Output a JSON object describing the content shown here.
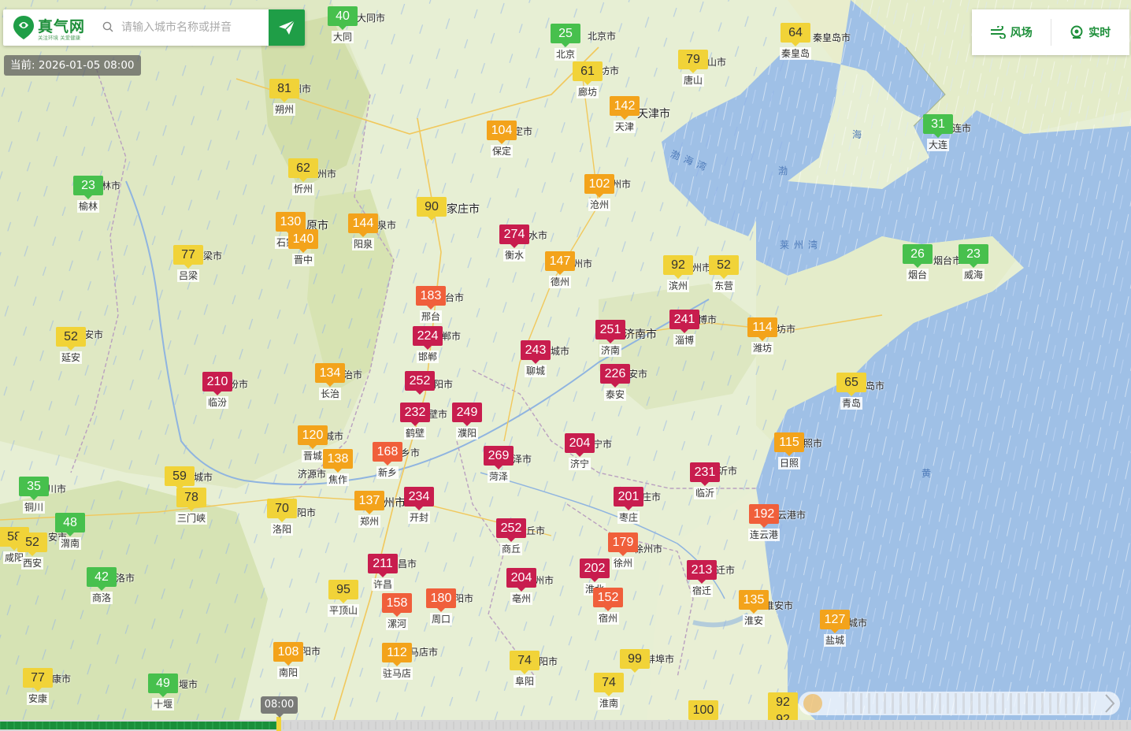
{
  "app": {
    "logo_name": "真气网",
    "logo_tagline": "关注环境 关爱健康",
    "search_placeholder": "请输入城市名称或拼音",
    "current_time_label": "当前: 2026-01-05 08:00",
    "wind_label": "风场",
    "realtime_label": "实时",
    "timeline_time": "08:00"
  },
  "aqi_levels": {
    "good": "#47c04d",
    "moderate": "#f1d338",
    "light": "#f3a31b",
    "medium": "#f05f3b",
    "heavy": "#c81d4e"
  },
  "markers": [
    {
      "aqi": "40",
      "level": "c1",
      "name": "大同"
    },
    {
      "aqi": "25",
      "level": "c1",
      "name": "北京"
    },
    {
      "aqi": "64",
      "level": "c2",
      "name": "秦皇岛"
    },
    {
      "aqi": "61",
      "level": "c2",
      "name": "廊坊"
    },
    {
      "aqi": "79",
      "level": "c2",
      "name": "唐山"
    },
    {
      "aqi": "81",
      "level": "c2",
      "name": "朔州"
    },
    {
      "aqi": "142",
      "level": "c3",
      "name": "天津"
    },
    {
      "aqi": "104",
      "level": "c3",
      "name": "保定"
    },
    {
      "aqi": "31",
      "level": "c1",
      "name": "大连"
    },
    {
      "aqi": "62",
      "level": "c2",
      "name": "忻州"
    },
    {
      "aqi": "23",
      "level": "c1",
      "name": "榆林"
    },
    {
      "aqi": "102",
      "level": "c3",
      "name": "沧州"
    },
    {
      "aqi": "90",
      "level": "c2",
      "name": ""
    },
    {
      "aqi": "130",
      "level": "c3",
      "name": "石家庄"
    },
    {
      "aqi": "144",
      "level": "c3",
      "name": "阳泉"
    },
    {
      "aqi": "140",
      "level": "c3",
      "name": "晋中"
    },
    {
      "aqi": "274",
      "level": "c5",
      "name": "衡水"
    },
    {
      "aqi": "77",
      "level": "c2",
      "name": "吕梁"
    },
    {
      "aqi": "147",
      "level": "c3",
      "name": "德州"
    },
    {
      "aqi": "92",
      "level": "c2",
      "name": "滨州"
    },
    {
      "aqi": "52",
      "level": "c2",
      "name": "东营"
    },
    {
      "aqi": "26",
      "level": "c1",
      "name": "烟台"
    },
    {
      "aqi": "23",
      "level": "c1",
      "name": "威海"
    },
    {
      "aqi": "183",
      "level": "c4",
      "name": "邢台"
    },
    {
      "aqi": "241",
      "level": "c5",
      "name": "淄博"
    },
    {
      "aqi": "251",
      "level": "c5",
      "name": "济南"
    },
    {
      "aqi": "114",
      "level": "c3",
      "name": "潍坊"
    },
    {
      "aqi": "52",
      "level": "c2",
      "name": "延安"
    },
    {
      "aqi": "224",
      "level": "c5",
      "name": "邯郸"
    },
    {
      "aqi": "243",
      "level": "c5",
      "name": "聊城"
    },
    {
      "aqi": "134",
      "level": "c3",
      "name": "长治"
    },
    {
      "aqi": "226",
      "level": "c5",
      "name": "泰安"
    },
    {
      "aqi": "65",
      "level": "c2",
      "name": "青岛"
    },
    {
      "aqi": "210",
      "level": "c5",
      "name": "临汾"
    },
    {
      "aqi": "252",
      "level": "c5",
      "name": ""
    },
    {
      "aqi": "232",
      "level": "c5",
      "name": "鹤壁"
    },
    {
      "aqi": "249",
      "level": "c5",
      "name": "濮阳"
    },
    {
      "aqi": "120",
      "level": "c3",
      "name": "晋城"
    },
    {
      "aqi": "204",
      "level": "c5",
      "name": "济宁"
    },
    {
      "aqi": "115",
      "level": "c3",
      "name": "日照"
    },
    {
      "aqi": "168",
      "level": "c4",
      "name": "新乡"
    },
    {
      "aqi": "138",
      "level": "c3",
      "name": "焦作"
    },
    {
      "aqi": "269",
      "level": "c5",
      "name": "菏泽"
    },
    {
      "aqi": "59",
      "level": "c2",
      "name": ""
    },
    {
      "aqi": "231",
      "level": "c5",
      "name": "临沂"
    },
    {
      "aqi": "35",
      "level": "c1",
      "name": "铜川"
    },
    {
      "aqi": "78",
      "level": "c2",
      "name": "三门峡"
    },
    {
      "aqi": "70",
      "level": "c2",
      "name": "洛阳"
    },
    {
      "aqi": "137",
      "level": "c3",
      "name": "郑州"
    },
    {
      "aqi": "234",
      "level": "c5",
      "name": "开封"
    },
    {
      "aqi": "201",
      "level": "c5",
      "name": "枣庄"
    },
    {
      "aqi": "192",
      "level": "c4",
      "name": "连云港"
    },
    {
      "aqi": "48",
      "level": "c1",
      "name": "渭南"
    },
    {
      "aqi": "58",
      "level": "c2",
      "name": "咸阳"
    },
    {
      "aqi": "52",
      "level": "c2",
      "name": "西安"
    },
    {
      "aqi": "252",
      "level": "c5",
      "name": "商丘"
    },
    {
      "aqi": "179",
      "level": "c4",
      "name": "徐州"
    },
    {
      "aqi": "211",
      "level": "c5",
      "name": "许昌"
    },
    {
      "aqi": "213",
      "level": "c5",
      "name": "宿迁"
    },
    {
      "aqi": "202",
      "level": "c5",
      "name": "淮北"
    },
    {
      "aqi": "42",
      "level": "c1",
      "name": "商洛"
    },
    {
      "aqi": "95",
      "level": "c2",
      "name": "平顶山"
    },
    {
      "aqi": "204",
      "level": "c5",
      "name": "亳州"
    },
    {
      "aqi": "158",
      "level": "c4",
      "name": "漯河"
    },
    {
      "aqi": "180",
      "level": "c4",
      "name": "周口"
    },
    {
      "aqi": "152",
      "level": "c4",
      "name": "宿州"
    },
    {
      "aqi": "135",
      "level": "c3",
      "name": "淮安"
    },
    {
      "aqi": "127",
      "level": "c3",
      "name": "盐城"
    },
    {
      "aqi": "108",
      "level": "c3",
      "name": "南阳"
    },
    {
      "aqi": "112",
      "level": "c3",
      "name": "驻马店"
    },
    {
      "aqi": "74",
      "level": "c2",
      "name": "阜阳"
    },
    {
      "aqi": "99",
      "level": "c2",
      "name": ""
    },
    {
      "aqi": "77",
      "level": "c2",
      "name": "安康"
    },
    {
      "aqi": "49",
      "level": "c1",
      "name": "十堰"
    },
    {
      "aqi": "74",
      "level": "c2",
      "name": "淮南"
    },
    {
      "aqi": "100",
      "level": "c2",
      "name": ""
    },
    {
      "aqi": "92",
      "level": "c2",
      "name": ""
    },
    {
      "aqi": "92",
      "level": "c2",
      "name": ""
    }
  ],
  "map_labels": [
    "大同市",
    "北京市",
    "秦皇岛市",
    "坊市",
    "山市",
    "州市",
    "天津市",
    "定市",
    "连市",
    "州市",
    "林市",
    "州市",
    "家庄市",
    "原市",
    "泉市",
    "水市",
    "梁市",
    "州市",
    "州市",
    "烟台市",
    "台市",
    "济南市",
    "博市",
    "坊市",
    "安市",
    "郸市",
    "城市",
    "治市",
    "安市",
    "岛市",
    "汾市",
    "阳市",
    "壁市",
    "城市",
    "乡市",
    "宁市",
    "照市",
    "泽市",
    "沂市",
    "济源市",
    "城市",
    "川市",
    "阳市",
    "州市",
    "庄市",
    "云港市",
    "安市",
    "洛市",
    "丘市",
    "徐州市",
    "昌市",
    "迁市",
    "州市",
    "淮安市",
    "阳市",
    "城市",
    "马店市",
    "阳市",
    "蚌埠市",
    "康市",
    "堰市",
    "阳市"
  ],
  "sea_labels": [
    "渤海湾",
    "渤",
    "海",
    "莱州湾",
    "黄"
  ]
}
